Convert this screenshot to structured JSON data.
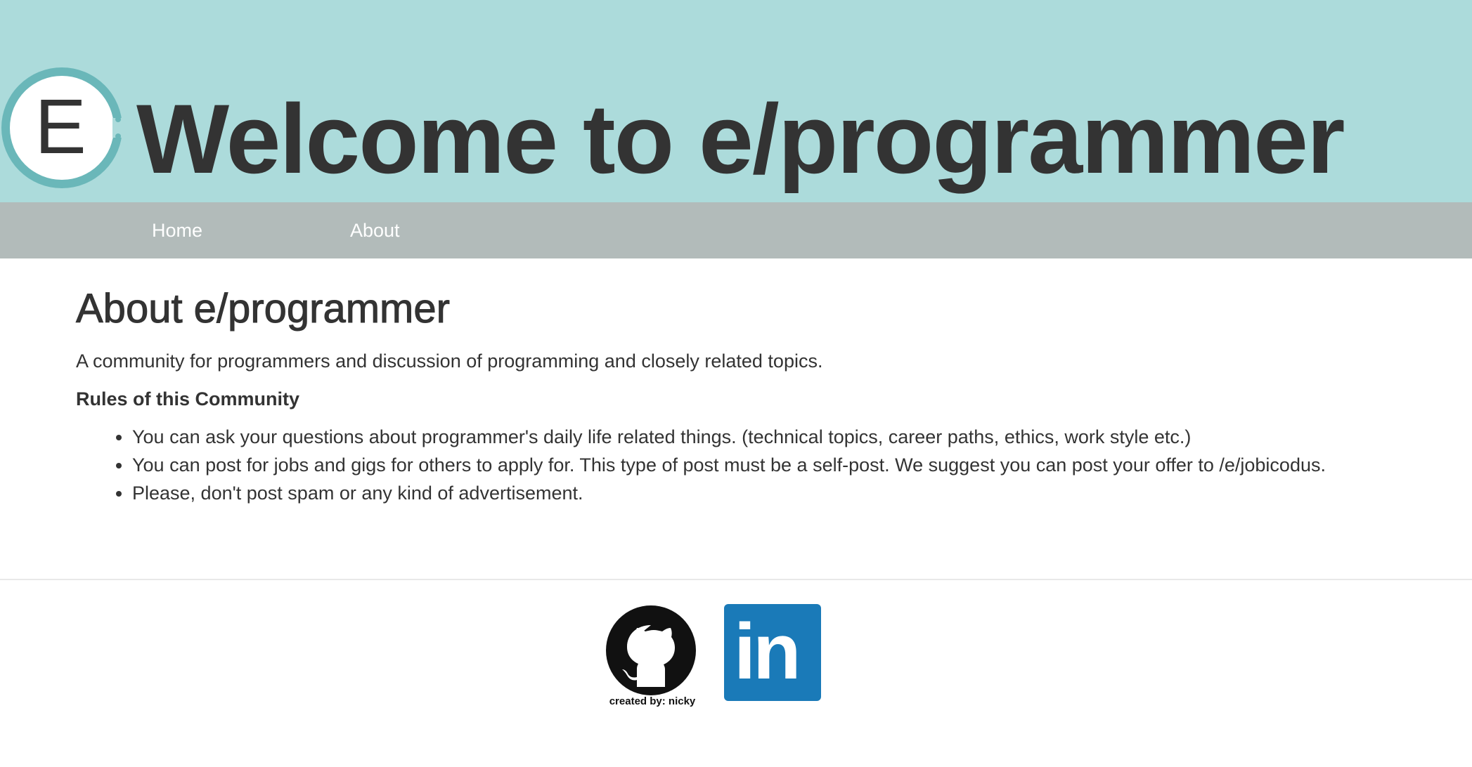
{
  "header": {
    "logo_letter": "E",
    "title": "Welcome to e/programmer"
  },
  "nav": {
    "items": [
      {
        "label": "Home"
      },
      {
        "label": "About"
      }
    ]
  },
  "main": {
    "heading": "About e/programmer",
    "description": "A community for programmers and discussion of programming and closely related topics.",
    "rules_heading": "Rules of this Community",
    "rules": [
      "You can ask your questions about programmer's daily life related things. (technical topics, career paths, ethics, work style etc.)",
      "You can post for jobs and gigs for others to apply for. This type of post must be a self-post. We suggest you can post your offer to /e/jobicodus.",
      "Please, don't post spam or any kind of advertisement."
    ]
  },
  "footer": {
    "github_caption": "created by: nicky",
    "linkedin_text": "in",
    "icons": [
      "github-icon",
      "linkedin-icon"
    ]
  },
  "colors": {
    "header_bg": "#acdbdb",
    "nav_bg": "#b2bbba",
    "logo_ring": "#6ab7b9",
    "text": "#333333",
    "linkedin_blue": "#1a7ab8"
  }
}
